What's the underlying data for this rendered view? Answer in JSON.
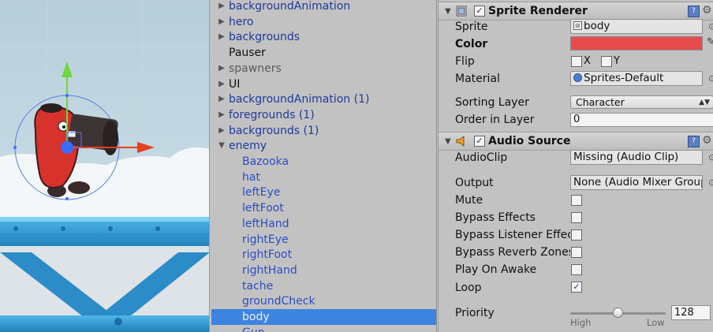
{
  "hierarchy": {
    "items": [
      {
        "label": "backgroundAnimation",
        "arrow": "▶",
        "depth": 0,
        "color": "blue"
      },
      {
        "label": "hero",
        "arrow": "▶",
        "depth": 0,
        "color": "blue"
      },
      {
        "label": "backgrounds",
        "arrow": "▶",
        "depth": 0,
        "color": "blue"
      },
      {
        "label": "Pauser",
        "arrow": "",
        "depth": 0,
        "color": "black"
      },
      {
        "label": "spawners",
        "arrow": "▶",
        "depth": 0,
        "color": "gray"
      },
      {
        "label": "UI",
        "arrow": "▶",
        "depth": 0,
        "color": "black"
      },
      {
        "label": "backgroundAnimation (1)",
        "arrow": "▶",
        "depth": 0,
        "color": "blue"
      },
      {
        "label": "foregrounds (1)",
        "arrow": "▶",
        "depth": 0,
        "color": "blue"
      },
      {
        "label": "backgrounds (1)",
        "arrow": "▶",
        "depth": 0,
        "color": "blue"
      },
      {
        "label": "enemy",
        "arrow": "▼",
        "depth": 0,
        "color": "blue"
      },
      {
        "label": "Bazooka",
        "arrow": "",
        "depth": 1,
        "color": "child"
      },
      {
        "label": "hat",
        "arrow": "",
        "depth": 1,
        "color": "child"
      },
      {
        "label": "leftEye",
        "arrow": "",
        "depth": 1,
        "color": "child"
      },
      {
        "label": "leftFoot",
        "arrow": "",
        "depth": 1,
        "color": "child"
      },
      {
        "label": "leftHand",
        "arrow": "",
        "depth": 1,
        "color": "child"
      },
      {
        "label": "rightEye",
        "arrow": "",
        "depth": 1,
        "color": "child"
      },
      {
        "label": "rightFoot",
        "arrow": "",
        "depth": 1,
        "color": "child"
      },
      {
        "label": "rightHand",
        "arrow": "",
        "depth": 1,
        "color": "child"
      },
      {
        "label": "tache",
        "arrow": "",
        "depth": 1,
        "color": "child"
      },
      {
        "label": "groundCheck",
        "arrow": "",
        "depth": 1,
        "color": "child"
      },
      {
        "label": "body",
        "arrow": "",
        "depth": 1,
        "color": "sel",
        "selected": true
      },
      {
        "label": "Gun",
        "arrow": "",
        "depth": 1,
        "color": "child"
      }
    ]
  },
  "sprite_renderer": {
    "title": "Sprite Renderer",
    "enabled": "✓",
    "sprite_label": "Sprite",
    "sprite_value": "body",
    "color_label": "Color",
    "color_value": "#e84b4b",
    "flip_label": "Flip",
    "flip_x": "X",
    "flip_y": "Y",
    "material_label": "Material",
    "material_value": "Sprites-Default",
    "sorting_layer_label": "Sorting Layer",
    "sorting_layer_value": "Character",
    "order_label": "Order in Layer",
    "order_value": "0"
  },
  "audio_source": {
    "title": "Audio Source",
    "enabled": "✓",
    "clip_label": "AudioClip",
    "clip_value": "Missing (Audio Clip)",
    "output_label": "Output",
    "output_value": "None (Audio Mixer Group)",
    "mute_label": "Mute",
    "bypass_effects_label": "Bypass Effects",
    "bypass_listener_label": "Bypass Listener Effects",
    "bypass_reverb_label": "Bypass Reverb Zones",
    "play_on_awake_label": "Play On Awake",
    "loop_label": "Loop",
    "loop_check": "✓",
    "priority_label": "Priority",
    "priority_value": "128",
    "priority_fraction": 0.5,
    "priority_high": "High",
    "priority_low": "Low"
  },
  "icons": {
    "fold": "▼",
    "book": "?",
    "gear": "⚙",
    "target": "⊙",
    "eyedropper": "✎",
    "dropdown": "▲▼"
  },
  "colors": {
    "selection": "#3d83e0",
    "sprite_color": "#e84b4b",
    "gizmo_green": "#6fd83a",
    "gizmo_red": "#e8401e"
  }
}
